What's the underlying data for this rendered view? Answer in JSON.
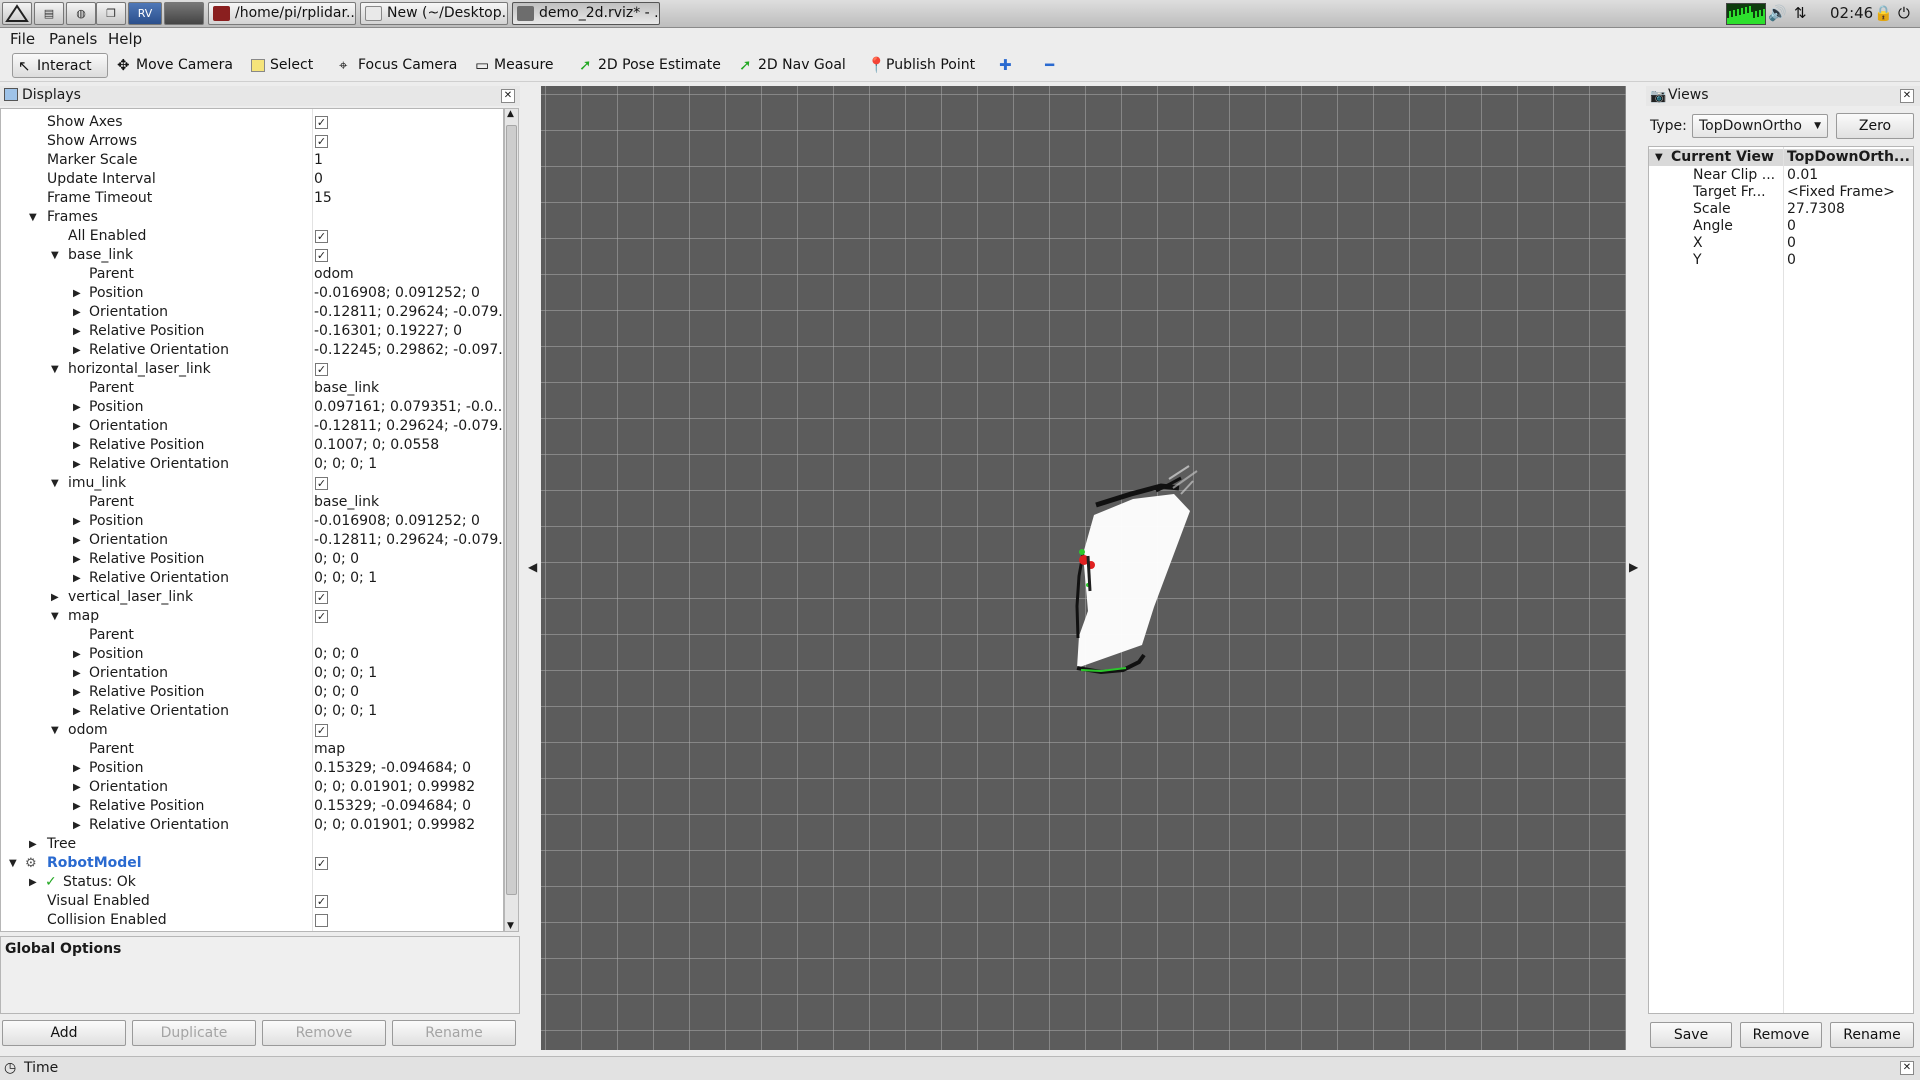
{
  "taskbar": {
    "tasks": [
      "/home/pi/rplidar...",
      "New (~/Desktop...",
      "demo_2d.rviz* - ..."
    ],
    "clock": "02:46"
  },
  "menu": {
    "file": "File",
    "panels": "Panels",
    "help": "Help"
  },
  "toolbar": {
    "interact": "Interact",
    "move_camera": "Move Camera",
    "select": "Select",
    "focus_camera": "Focus Camera",
    "measure": "Measure",
    "pose_estimate": "2D Pose Estimate",
    "nav_goal": "2D Nav Goal",
    "publish_point": "Publish Point"
  },
  "displays": {
    "title": "Displays",
    "rows": [
      {
        "label": "Show Axes",
        "check": true
      },
      {
        "label": "Show Arrows",
        "check": true
      },
      {
        "label": "Marker Scale",
        "value": "1"
      },
      {
        "label": "Update Interval",
        "value": "0"
      },
      {
        "label": "Frame Timeout",
        "value": "15"
      },
      {
        "label": "Frames"
      },
      {
        "label": "All Enabled",
        "check": true
      },
      {
        "label": "base_link",
        "check": true
      },
      {
        "label": "Parent",
        "value": "odom"
      },
      {
        "label": "Position",
        "value": "-0.016908; 0.091252; 0"
      },
      {
        "label": "Orientation",
        "value": "-0.12811; 0.29624; -0.079..."
      },
      {
        "label": "Relative Position",
        "value": "-0.16301; 0.19227; 0"
      },
      {
        "label": "Relative Orientation",
        "value": "-0.12245; 0.29862; -0.097..."
      },
      {
        "label": "horizontal_laser_link",
        "check": true
      },
      {
        "label": "Parent",
        "value": "base_link"
      },
      {
        "label": "Position",
        "value": "0.097161; 0.079351; -0.0..."
      },
      {
        "label": "Orientation",
        "value": "-0.12811; 0.29624; -0.079..."
      },
      {
        "label": "Relative Position",
        "value": "0.1007; 0; 0.0558"
      },
      {
        "label": "Relative Orientation",
        "value": "0; 0; 0; 1"
      },
      {
        "label": "imu_link",
        "check": true
      },
      {
        "label": "Parent",
        "value": "base_link"
      },
      {
        "label": "Position",
        "value": "-0.016908; 0.091252; 0"
      },
      {
        "label": "Orientation",
        "value": "-0.12811; 0.29624; -0.079..."
      },
      {
        "label": "Relative Position",
        "value": "0; 0; 0"
      },
      {
        "label": "Relative Orientation",
        "value": "0; 0; 0; 1"
      },
      {
        "label": "vertical_laser_link",
        "check": true
      },
      {
        "label": "map",
        "check": true
      },
      {
        "label": "Parent",
        "value": ""
      },
      {
        "label": "Position",
        "value": "0; 0; 0"
      },
      {
        "label": "Orientation",
        "value": "0; 0; 0; 1"
      },
      {
        "label": "Relative Position",
        "value": "0; 0; 0"
      },
      {
        "label": "Relative Orientation",
        "value": "0; 0; 0; 1"
      },
      {
        "label": "odom",
        "check": true
      },
      {
        "label": "Parent",
        "value": "map"
      },
      {
        "label": "Position",
        "value": "0.15329; -0.094684; 0"
      },
      {
        "label": "Orientation",
        "value": "0; 0; 0.01901; 0.99982"
      },
      {
        "label": "Relative Position",
        "value": "0.15329; -0.094684; 0"
      },
      {
        "label": "Relative Orientation",
        "value": "0; 0; 0.01901; 0.99982"
      },
      {
        "label": "Tree"
      },
      {
        "label": "RobotModel",
        "check": true
      },
      {
        "label": "Status: Ok"
      },
      {
        "label": "Visual Enabled",
        "check": true
      },
      {
        "label": "Collision Enabled",
        "check": false
      }
    ],
    "global_options": "Global Options",
    "buttons": {
      "add": "Add",
      "duplicate": "Duplicate",
      "remove": "Remove",
      "rename": "Rename"
    }
  },
  "views": {
    "title": "Views",
    "type_label": "Type:",
    "type_value": "TopDownOrtho",
    "zero": "Zero",
    "current_view": "Current View",
    "current_view_type": "TopDownOrth...",
    "props": [
      {
        "k": "Near Clip ...",
        "v": "0.01"
      },
      {
        "k": "Target Fr...",
        "v": "<Fixed Frame>"
      },
      {
        "k": "Scale",
        "v": "27.7308"
      },
      {
        "k": "Angle",
        "v": "0"
      },
      {
        "k": "X",
        "v": "0"
      },
      {
        "k": "Y",
        "v": "0"
      }
    ],
    "buttons": {
      "save": "Save",
      "remove": "Remove",
      "rename": "Rename"
    }
  },
  "status": {
    "time": "Time"
  },
  "colors": {
    "viewport_bg": "#5c5c5c",
    "grid": "#aaaaaa",
    "accent": "#2a6ad0"
  }
}
